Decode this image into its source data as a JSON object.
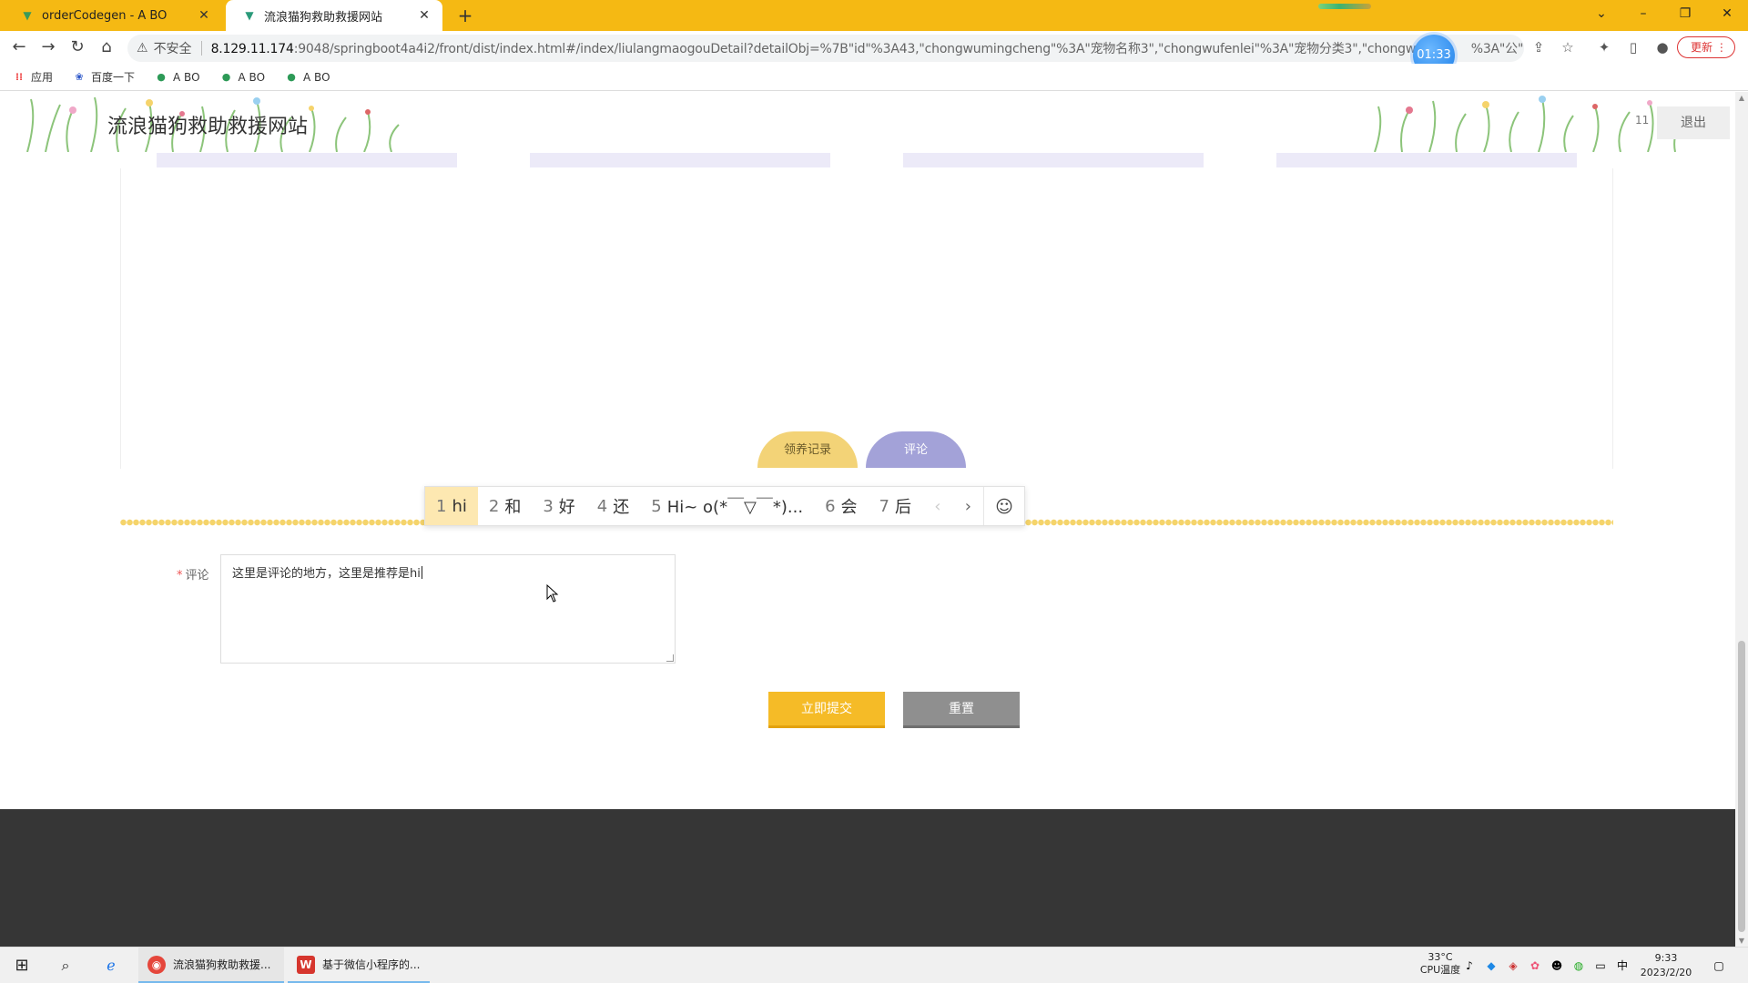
{
  "browser": {
    "tabs": [
      {
        "title": "orderCodegen - A BO",
        "icon": "vue-icon",
        "active": false
      },
      {
        "title": "流浪猫狗救助救援网站",
        "icon": "vue-icon",
        "active": true
      }
    ],
    "new_tab": "+",
    "window_controls": {
      "minimize": "–",
      "restore": "❐",
      "close": "✕",
      "tab_search": "⌄"
    },
    "address": {
      "not_secure": "不安全",
      "url_host": "8.129.11.174",
      "url_rest": ":9048/springboot4a4i2/front/dist/index.html#/index/liulangmaogouDetail?detailObj=%7B\"id\"%3A43,\"chongwumingcheng\"%3A\"宠物名称3\",\"chongwufenlei\"%3A\"宠物分类3\",\"chongwu",
      "url_tail": "%3A\"公\",..."
    },
    "timer": "01:33",
    "update_label": "更新"
  },
  "bookmarks": [
    {
      "label": "应用",
      "icon": "apps-grid-icon"
    },
    {
      "label": "百度一下",
      "icon": "paw-icon"
    },
    {
      "label": "A BO",
      "icon": "leaf-icon"
    },
    {
      "label": "A BO",
      "icon": "leaf-icon"
    },
    {
      "label": "A BO",
      "icon": "leaf-icon"
    }
  ],
  "site": {
    "title": "流浪猫狗救助救援网站",
    "logout": "退出",
    "header_icon": "11"
  },
  "detail_tabs": {
    "adopt": "领养记录",
    "comment": "评论"
  },
  "comment_form": {
    "required_mark": "*",
    "label": "评论",
    "value": "这里是评论的地方，这里是推荐是hi",
    "submit": "立即提交",
    "reset": "重置"
  },
  "ime": {
    "candidates": [
      {
        "num": "1",
        "text": "hi"
      },
      {
        "num": "2",
        "text": "和"
      },
      {
        "num": "3",
        "text": "好"
      },
      {
        "num": "4",
        "text": "还"
      },
      {
        "num": "5",
        "text": "Hi~ o(*￣▽￣*)..."
      },
      {
        "num": "6",
        "text": "会"
      },
      {
        "num": "7",
        "text": "后"
      }
    ],
    "prev": "‹",
    "next": "›",
    "emoji": "☺"
  },
  "taskbar": {
    "apps": [
      {
        "label": "流浪猫狗救助救援...",
        "icon": "chrome-icon"
      },
      {
        "label": "基于微信小程序的...",
        "icon": "wps-icon"
      }
    ],
    "temp": "33°C",
    "temp_label": "CPU温度",
    "ime_mode": "中",
    "time": "9:33",
    "date": "2023/2/20"
  }
}
